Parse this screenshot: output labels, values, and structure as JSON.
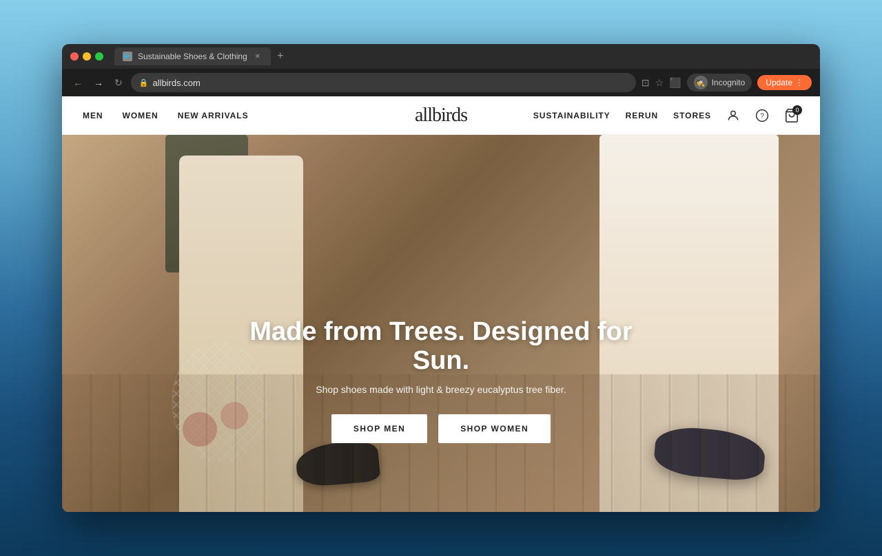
{
  "browser": {
    "tab_title": "Sustainable Shoes & Clothing",
    "url": "allbirds.com",
    "update_label": "Update",
    "incognito_label": "Incognito"
  },
  "nav": {
    "logo": "allbirds",
    "left_items": [
      {
        "id": "men",
        "label": "MEN"
      },
      {
        "id": "women",
        "label": "WOMEN"
      },
      {
        "id": "new-arrivals",
        "label": "NEW ARRIVALS"
      }
    ],
    "right_items": [
      {
        "id": "sustainability",
        "label": "SUSTAINABILITY"
      },
      {
        "id": "rerun",
        "label": "RERUN"
      },
      {
        "id": "stores",
        "label": "STORES"
      }
    ],
    "cart_count": "0"
  },
  "hero": {
    "title": "Made from Trees. Designed for Sun.",
    "subtitle": "Shop shoes made with light & breezy eucalyptus tree fiber.",
    "btn_shop_men": "SHOP MEN",
    "btn_shop_women": "SHOP WOMEN"
  }
}
